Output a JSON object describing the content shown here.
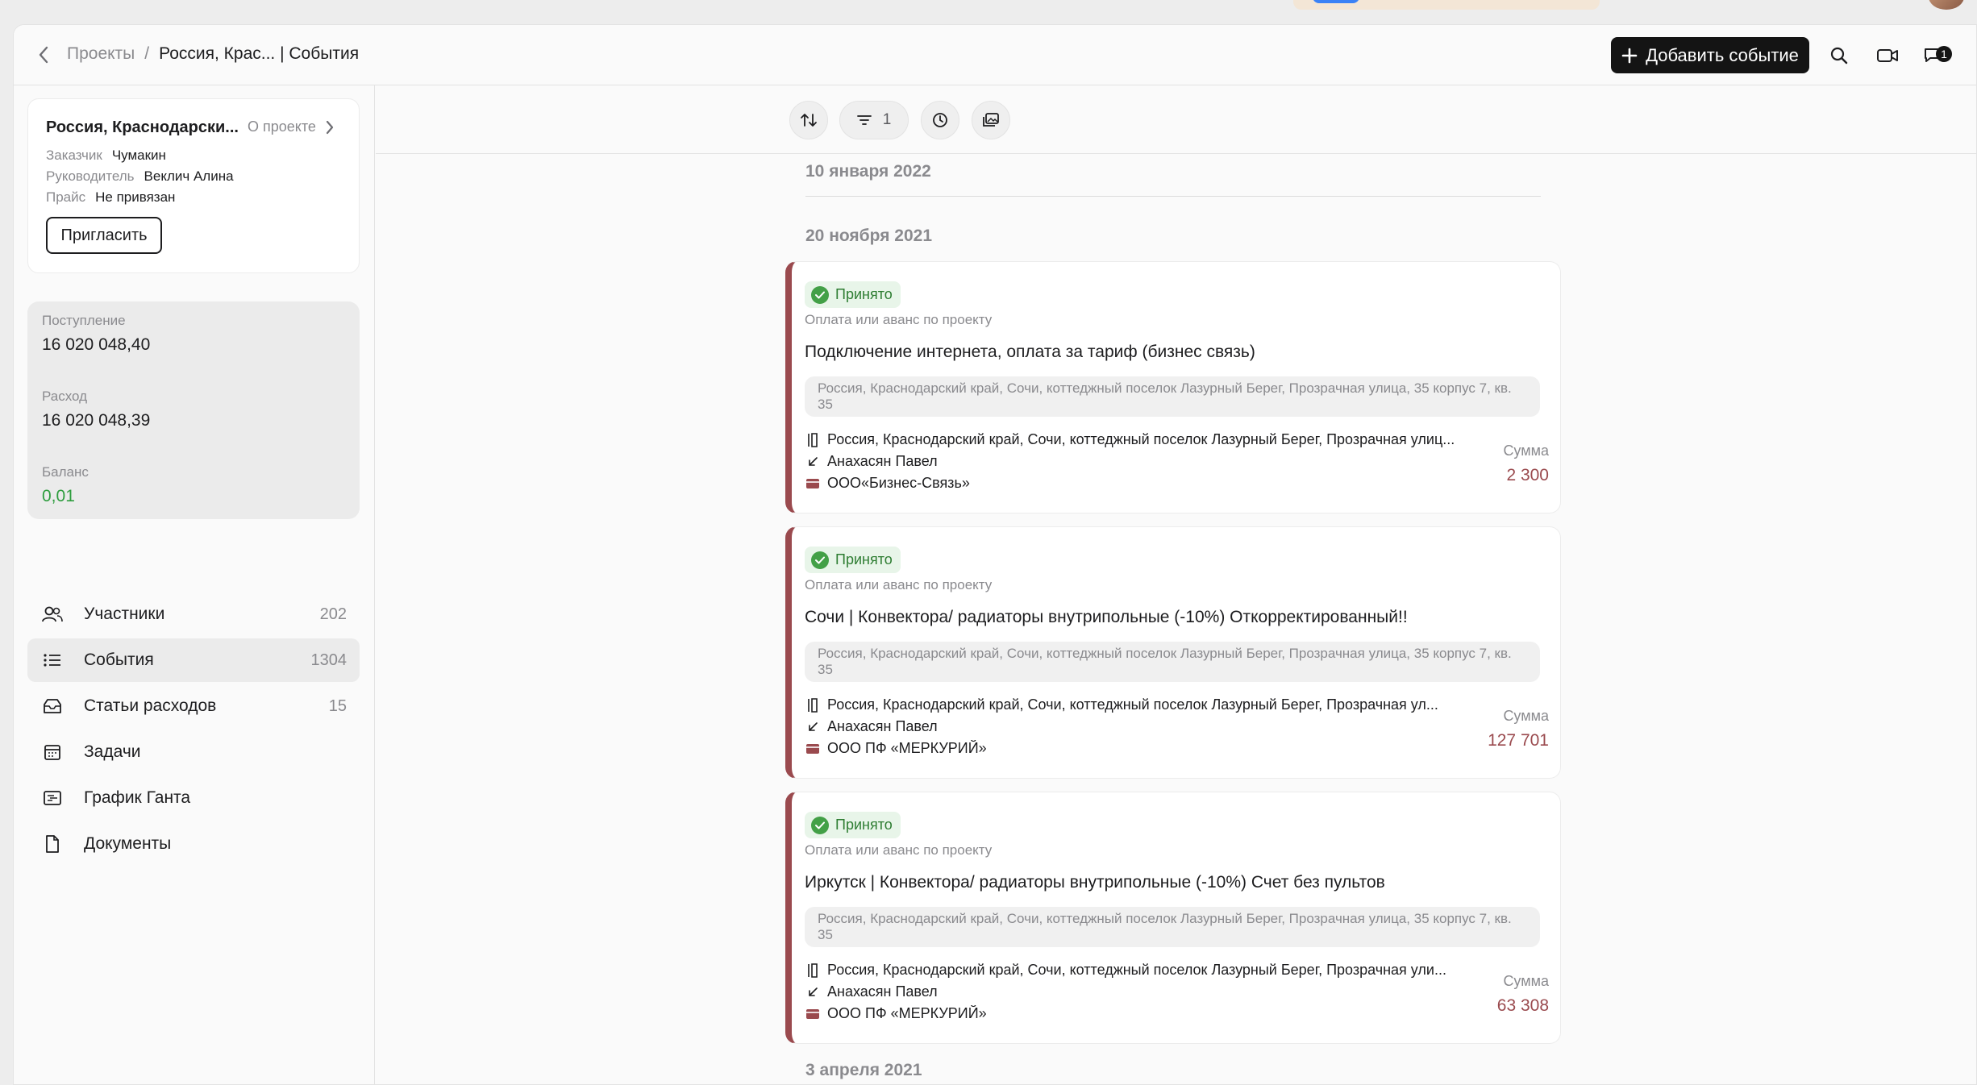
{
  "header": {
    "breadcrumb_root": "Проекты",
    "breadcrumb_sep": "/",
    "breadcrumb_current": "Россия, Крас... | События",
    "add_event_label": "Добавить событие",
    "chat_badge": "1"
  },
  "project": {
    "title": "Россия, Краснодарски...",
    "about_label": "О проекте",
    "customer_key": "Заказчик",
    "customer_value": "Чумакин",
    "manager_key": "Руководитель",
    "manager_value": "Веклич Алина",
    "price_key": "Прайс",
    "price_value": "Не привязан",
    "invite_label": "Пригласить"
  },
  "finance": {
    "income_label": "Поступление",
    "income_value": "16 020 048,40",
    "expense_label": "Расход",
    "expense_value": "16 020 048,39",
    "balance_label": "Баланс",
    "balance_value": "0,01",
    "balance_color": "#2e9d3e"
  },
  "nav": [
    {
      "label": "Участники",
      "count": "202",
      "icon": "users-icon"
    },
    {
      "label": "События",
      "count": "1304",
      "icon": "list-icon"
    },
    {
      "label": "Статьи расходов",
      "count": "15",
      "icon": "inbox-icon"
    },
    {
      "label": "Задачи",
      "count": "",
      "icon": "calendar-icon"
    },
    {
      "label": "График Ганта",
      "count": "",
      "icon": "gantt-icon"
    },
    {
      "label": "Документы",
      "count": "",
      "icon": "document-icon"
    }
  ],
  "toolbar": {
    "filter_count": "1"
  },
  "feed": {
    "date1": "10 января 2022",
    "date2": "20 ноября 2021",
    "date3": "3 апреля 2021",
    "accent_color": "#9a4a4e",
    "events": [
      {
        "status": "Принято",
        "type": "Оплата или аванс по проекту",
        "title": "Подключение интернета, оплата за тариф (бизнес связь)",
        "address": "Россия, Краснодарский край, Сочи, коттеджный поселок Лазурный Берег, Прозрачная улица, 35 корпус 7, кв. 35",
        "object": "Россия, Краснодарский край, Сочи, коттеджный поселок Лазурный Берег, Прозрачная улиц...",
        "person": "Анахасян Павел",
        "counterparty": "ООО«Бизнес-Связь»",
        "sum_label": "Сумма",
        "sum": "2 300"
      },
      {
        "status": "Принято",
        "type": "Оплата или аванс по проекту",
        "title": "Сочи | Конвектора/ радиаторы внутрипольные (-10%) Откорректированный!!",
        "address": "Россия, Краснодарский край, Сочи, коттеджный поселок Лазурный Берег, Прозрачная улица, 35 корпус 7, кв. 35",
        "object": "Россия, Краснодарский край, Сочи, коттеджный поселок Лазурный Берег, Прозрачная ул...",
        "person": "Анахасян Павел",
        "counterparty": "ООО ПФ «МЕРКУРИЙ»",
        "sum_label": "Сумма",
        "sum": "127 701"
      },
      {
        "status": "Принято",
        "type": "Оплата или аванс по проекту",
        "title": "Иркутск | Конвектора/ радиаторы внутрипольные (-10%) Счет без пультов",
        "address": "Россия, Краснодарский край, Сочи, коттеджный поселок Лазурный Берег, Прозрачная улица, 35 корпус 7, кв. 35",
        "object": "Россия, Краснодарский край, Сочи, коттеджный поселок Лазурный Берег, Прозрачная ули...",
        "person": "Анахасян Павел",
        "counterparty": "ООО ПФ «МЕРКУРИЙ»",
        "sum_label": "Сумма",
        "sum": "63 308"
      }
    ]
  }
}
